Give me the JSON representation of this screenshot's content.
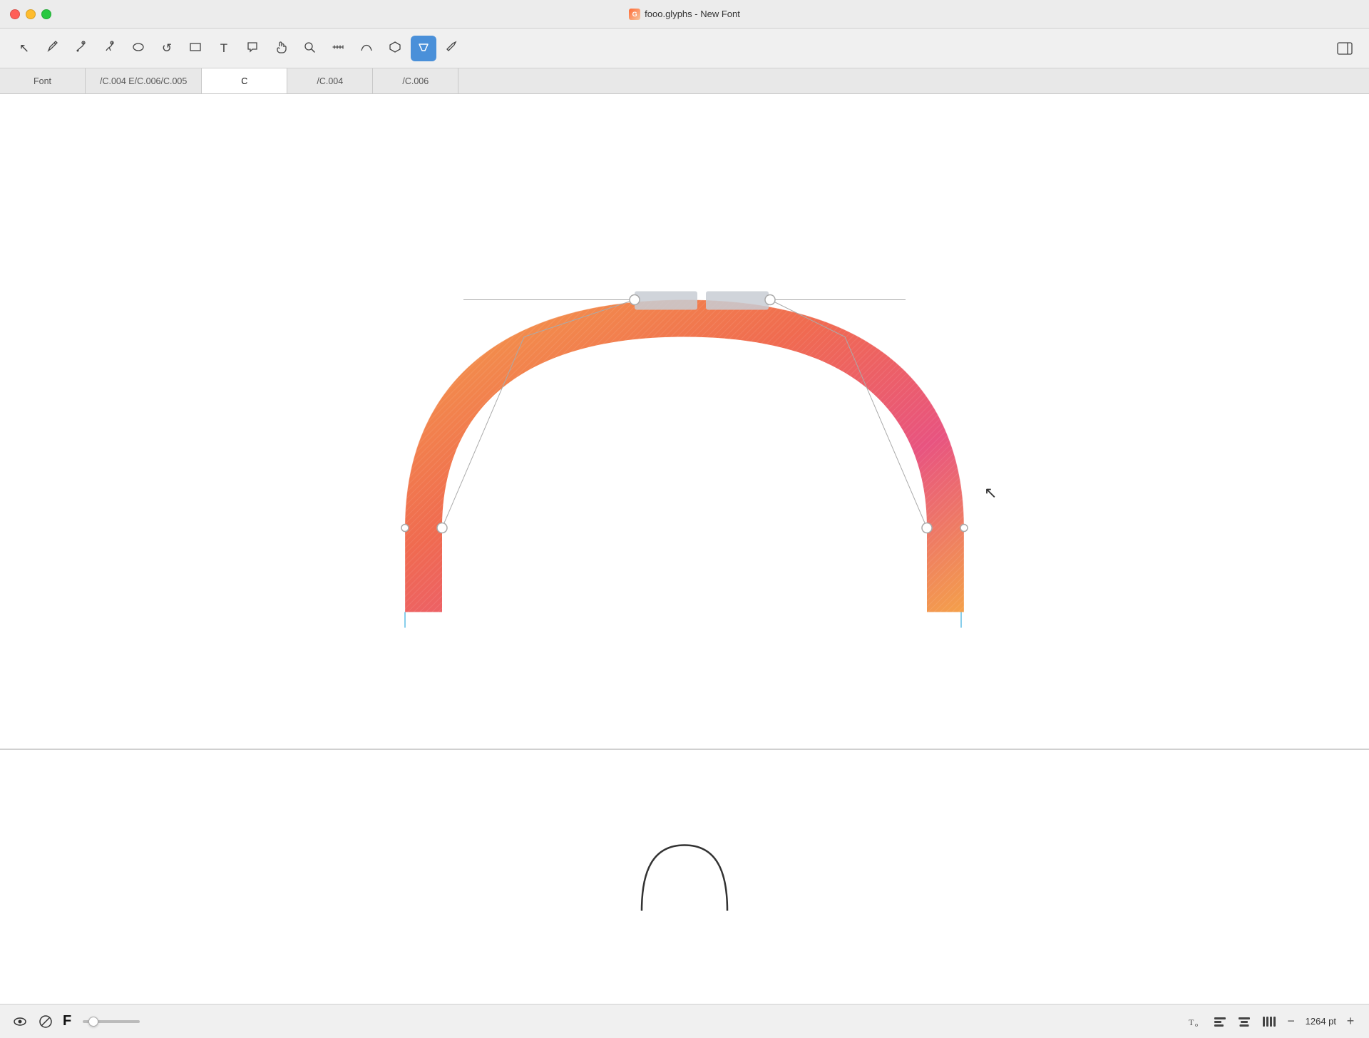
{
  "window": {
    "title": "fooo.glyphs - New Font",
    "app_icon": "G"
  },
  "titlebar": {
    "close_label": "",
    "minimize_label": "",
    "maximize_label": ""
  },
  "toolbar": {
    "tools": [
      {
        "name": "select-tool",
        "icon": "↖",
        "label": "Select",
        "active": false
      },
      {
        "name": "draw-pencil-tool",
        "icon": "✏",
        "label": "Draw Pencil",
        "active": false
      },
      {
        "name": "pen-tool",
        "icon": "🖊",
        "label": "Pen",
        "active": false
      },
      {
        "name": "pen-alt-tool",
        "icon": "✒",
        "label": "Pen Alt",
        "active": false
      },
      {
        "name": "circle-tool",
        "icon": "○",
        "label": "Circle",
        "active": false
      },
      {
        "name": "undo-tool",
        "icon": "↺",
        "label": "Undo",
        "active": false
      },
      {
        "name": "rect-tool",
        "icon": "▣",
        "label": "Rectangle",
        "active": false
      },
      {
        "name": "text-tool",
        "icon": "T",
        "label": "Text",
        "active": false
      },
      {
        "name": "comment-tool",
        "icon": "💬",
        "label": "Comment",
        "active": false
      },
      {
        "name": "hand-tool",
        "icon": "✋",
        "label": "Hand",
        "active": false
      },
      {
        "name": "zoom-tool",
        "icon": "🔍",
        "label": "Zoom",
        "active": false
      },
      {
        "name": "measure-tool",
        "icon": "📏",
        "label": "Measure",
        "active": false
      },
      {
        "name": "curve-tool",
        "icon": "⌒",
        "label": "Curve",
        "active": false
      },
      {
        "name": "component-tool",
        "icon": "❖",
        "label": "Component",
        "active": false
      },
      {
        "name": "anchor-tool",
        "icon": "⚓",
        "label": "Anchor",
        "active": true
      },
      {
        "name": "knife-tool",
        "icon": "✂",
        "label": "Knife",
        "active": false
      }
    ],
    "sidebar_toggle": "sidebar-toggle"
  },
  "tabs": [
    {
      "id": "font-tab",
      "label": "Font",
      "active": false
    },
    {
      "id": "glyph-tab-1",
      "label": "/C.004 E/C.006/C.005",
      "active": false
    },
    {
      "id": "glyph-tab-c",
      "label": "C",
      "active": true
    },
    {
      "id": "glyph-tab-2",
      "label": "/C.004",
      "active": false
    },
    {
      "id": "glyph-tab-3",
      "label": "/C.006",
      "active": false
    }
  ],
  "statusbar": {
    "font_size_label": "1264 pt",
    "zoom_in_label": "+",
    "zoom_out_label": "−",
    "font_letter": "F",
    "eye_icon": "👁",
    "tools": [
      {
        "name": "metrics-tool",
        "label": "Tₒ"
      },
      {
        "name": "align-left",
        "label": "⬛"
      },
      {
        "name": "align-center",
        "label": "⬛"
      },
      {
        "name": "align-bars",
        "label": "⬛"
      }
    ]
  },
  "canvas": {
    "arch": {
      "description": "Arch shape with gradient fill, showing bezier control handles"
    },
    "preview": {
      "description": "Small outline preview of arch at bottom"
    }
  }
}
